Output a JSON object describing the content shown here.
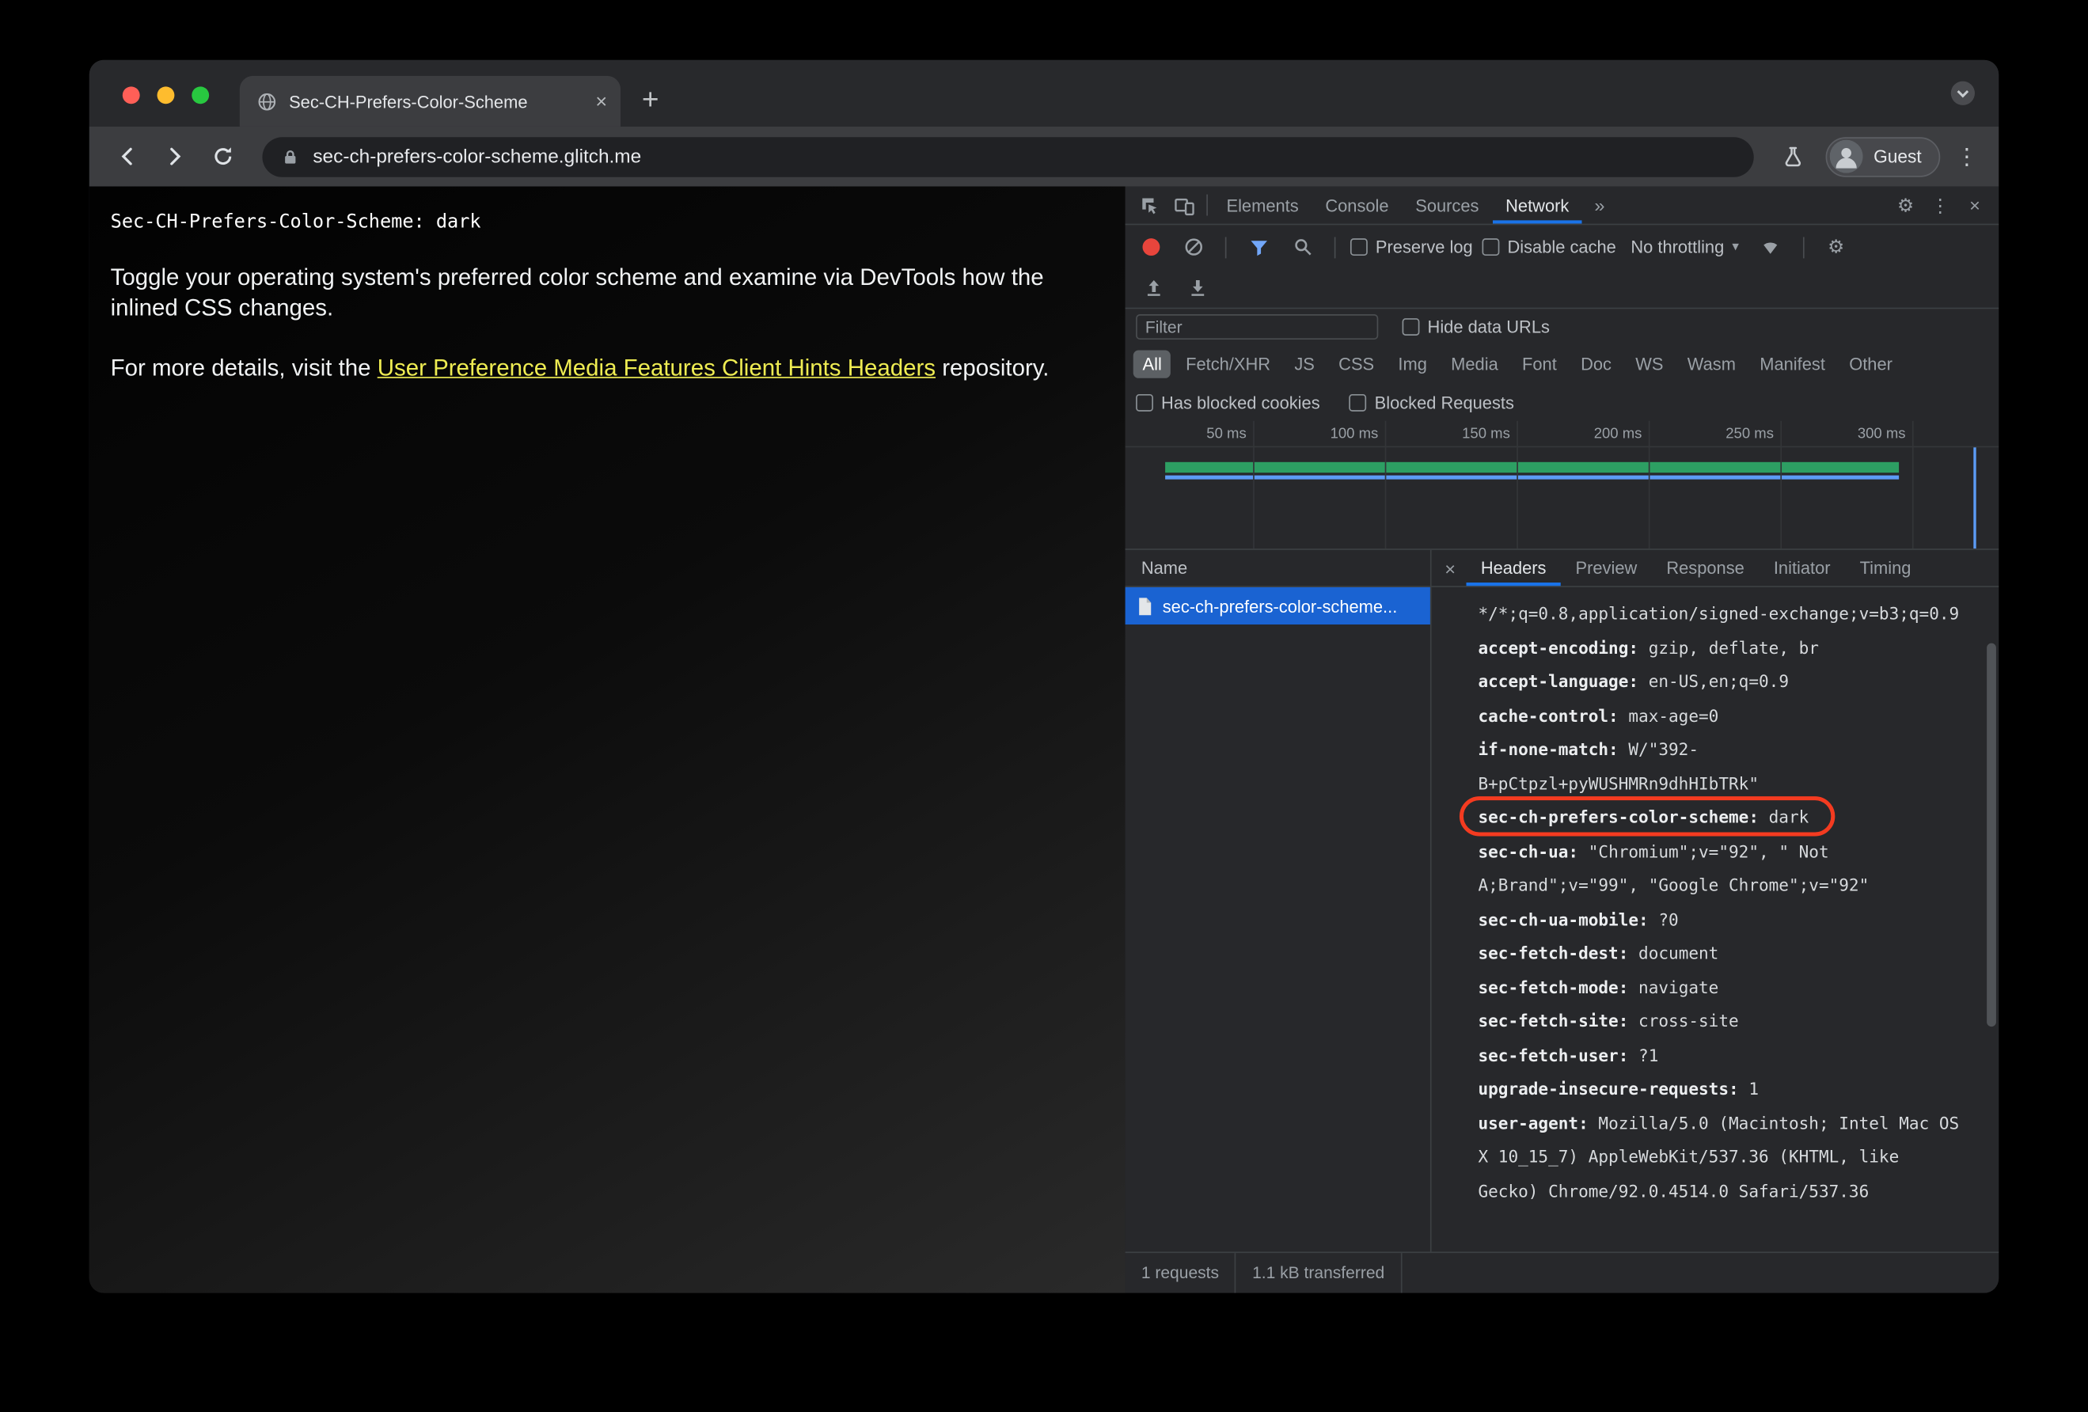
{
  "theme": {
    "mac_red": "#ff5f57",
    "mac_yellow": "#febc2e",
    "mac_green": "#28c840",
    "link_yellow": "#eeec52",
    "selection_blue": "#1a63d2",
    "record_red": "#e8453c",
    "annotation_red": "#f43b20",
    "timeline_green": "#2d9f63",
    "timeline_blue": "#5c9bf5",
    "accent_blue": "#1a73e8"
  },
  "icons": {
    "close": "×",
    "new_tab": "+",
    "overflow": "»",
    "menu": "⋮",
    "gear": "⚙",
    "caret": "▾"
  },
  "browser": {
    "tab_title": "Sec-CH-Prefers-Color-Scheme",
    "url": "sec-ch-prefers-color-scheme.glitch.me",
    "profile_label": "Guest"
  },
  "page": {
    "status_line": "Sec-CH-Prefers-Color-Scheme: dark",
    "paragraph1": "Toggle your operating system's preferred color scheme and examine via DevTools how the inlined CSS changes.",
    "paragraph2_prefix": "For more details, visit the ",
    "link_text": "User Preference Media Features Client Hints Headers",
    "paragraph2_suffix": " repository."
  },
  "devtools": {
    "main_tabs": [
      "Elements",
      "Console",
      "Sources",
      "Network"
    ],
    "active_main_tab": "Network",
    "network_toolbar": {
      "preserve_log": "Preserve log",
      "disable_cache": "Disable cache",
      "throttling": "No throttling"
    },
    "filter": {
      "placeholder": "Filter",
      "hide_data_urls": "Hide data URLs",
      "types": [
        "All",
        "Fetch/XHR",
        "JS",
        "CSS",
        "Img",
        "Media",
        "Font",
        "Doc",
        "WS",
        "Wasm",
        "Manifest",
        "Other"
      ],
      "active_type": "All",
      "has_blocked_cookies": "Has blocked cookies",
      "blocked_requests": "Blocked Requests"
    },
    "timeline": {
      "ticks": [
        "50 ms",
        "100 ms",
        "150 ms",
        "200 ms",
        "250 ms",
        "300 ms"
      ]
    },
    "request_table": {
      "name_header": "Name",
      "rows": [
        {
          "name": "sec-ch-prefers-color-scheme..."
        }
      ]
    },
    "detail_tabs": [
      "Headers",
      "Preview",
      "Response",
      "Initiator",
      "Timing"
    ],
    "active_detail_tab": "Headers",
    "headers": [
      {
        "name": "",
        "value": "*/*;q=0.8,application/signed-exchange;v=b3;q=0.9"
      },
      {
        "name": "accept-encoding",
        "value": "gzip, deflate, br"
      },
      {
        "name": "accept-language",
        "value": "en-US,en;q=0.9"
      },
      {
        "name": "cache-control",
        "value": "max-age=0"
      },
      {
        "name": "if-none-match",
        "value": "W/\"392-B+pCtpzl+pyWUSHMRn9dhHIbTRk\""
      },
      {
        "name": "sec-ch-prefers-color-scheme",
        "value": "dark",
        "annotated": true
      },
      {
        "name": "sec-ch-ua",
        "value": "\"Chromium\";v=\"92\", \" Not A;Brand\";v=\"99\", \"Google Chrome\";v=\"92\""
      },
      {
        "name": "sec-ch-ua-mobile",
        "value": "?0"
      },
      {
        "name": "sec-fetch-dest",
        "value": "document"
      },
      {
        "name": "sec-fetch-mode",
        "value": "navigate"
      },
      {
        "name": "sec-fetch-site",
        "value": "cross-site"
      },
      {
        "name": "sec-fetch-user",
        "value": "?1"
      },
      {
        "name": "upgrade-insecure-requests",
        "value": "1"
      },
      {
        "name": "user-agent",
        "value": "Mozilla/5.0 (Macintosh; Intel Mac OS X 10_15_7) AppleWebKit/537.36 (KHTML, like Gecko) Chrome/92.0.4514.0 Safari/537.36"
      }
    ],
    "status_bar": {
      "requests": "1 requests",
      "transferred": "1.1 kB transferred"
    }
  }
}
